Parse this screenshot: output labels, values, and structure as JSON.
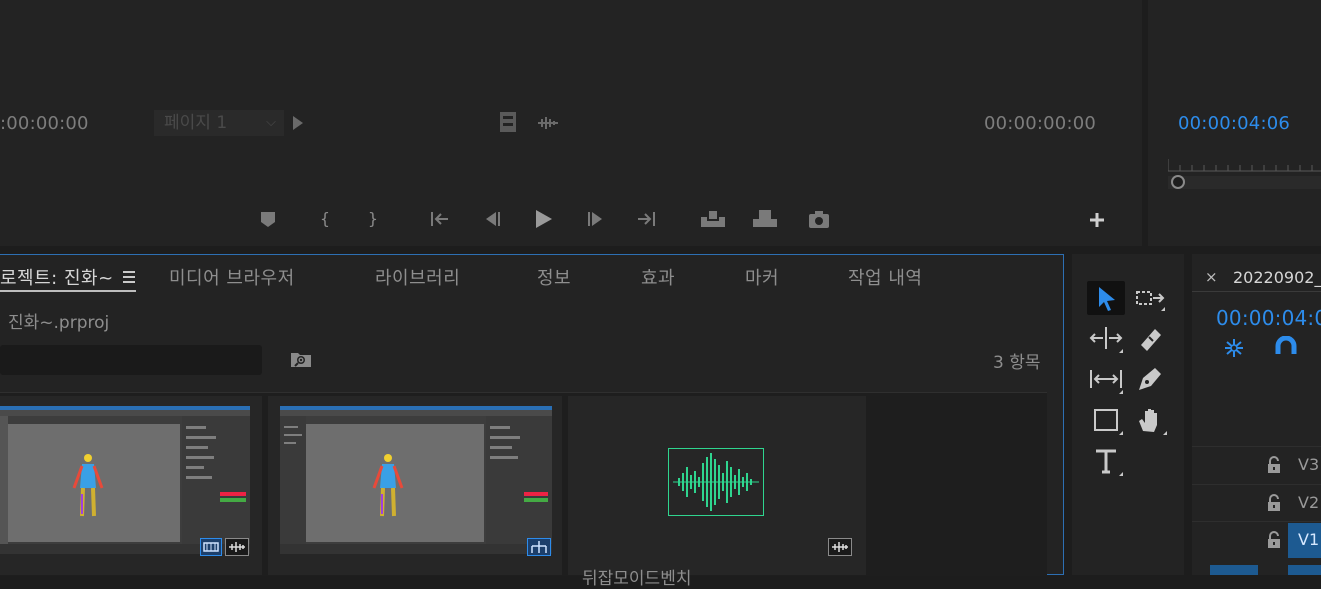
{
  "source_monitor": {
    "timecode_left": ":00:00:00",
    "page_select": "페이지 1",
    "timecode_right": "00:00:00:00"
  },
  "program_monitor": {
    "timecode": "00:00:04:06"
  },
  "project": {
    "tabs": [
      {
        "label": "로젝트: 진화~",
        "active": true
      },
      {
        "label": "미디어 브라우저"
      },
      {
        "label": "라이브러리"
      },
      {
        "label": "정보"
      },
      {
        "label": "효과"
      },
      {
        "label": "마커"
      },
      {
        "label": "작업 내역"
      }
    ],
    "file_name": "진화~.prproj",
    "item_count": "3 항목",
    "items": [
      {
        "name": "",
        "type": "video"
      },
      {
        "name": "",
        "type": "video"
      },
      {
        "name": "뒤잡모이드벤치",
        "type": "audio"
      }
    ]
  },
  "timeline": {
    "sequence_name": "20220902_",
    "timecode": "00:00:04:0",
    "tracks": [
      "V3",
      "V2",
      "V1"
    ]
  },
  "colors": {
    "accent": "#2d8ceb",
    "audio_waveform": "#2fd58f",
    "panel_border_active": "#2d6fb3"
  }
}
